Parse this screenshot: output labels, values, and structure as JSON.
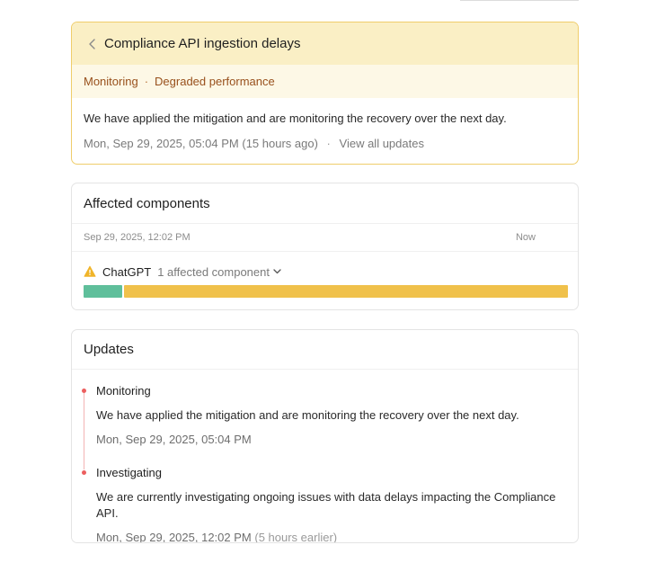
{
  "incident": {
    "title": "Compliance API ingestion delays",
    "status": "Monitoring",
    "severity": "Degraded performance",
    "separator": "·",
    "message": "We have applied the mitigation and are monitoring the recovery over the next day.",
    "timestamp": "Mon, Sep 29, 2025, 05:04 PM",
    "relative_time": "(15 hours ago)",
    "view_all_label": "View all updates",
    "colors": {
      "header_bg": "#faefc5",
      "status_bg": "#fdf8e6",
      "status_text": "#98501c",
      "border": "#efcd6b"
    }
  },
  "affected": {
    "heading": "Affected components",
    "range_start": "Sep 29, 2025, 12:02 PM",
    "range_end": "Now",
    "component": {
      "icon": "warning-icon",
      "name": "ChatGPT",
      "count_label": "1 affected component"
    },
    "bar_segments": [
      {
        "state": "operational",
        "fraction": 0.08,
        "color": "#5fbf9b"
      },
      {
        "state": "degraded",
        "fraction": 0.92,
        "color": "#f0c14b"
      }
    ]
  },
  "updates": {
    "heading": "Updates",
    "items": [
      {
        "status": "Monitoring",
        "message": "We have applied the mitigation and are monitoring the recovery over the next day.",
        "time": "Mon, Sep 29, 2025, 05:04 PM",
        "relative": ""
      },
      {
        "status": "Investigating",
        "message": "We are currently investigating ongoing issues with data delays impacting the Compliance API.",
        "time": "Mon, Sep 29, 2025, 12:02 PM",
        "relative": "(5 hours earlier)"
      }
    ]
  }
}
